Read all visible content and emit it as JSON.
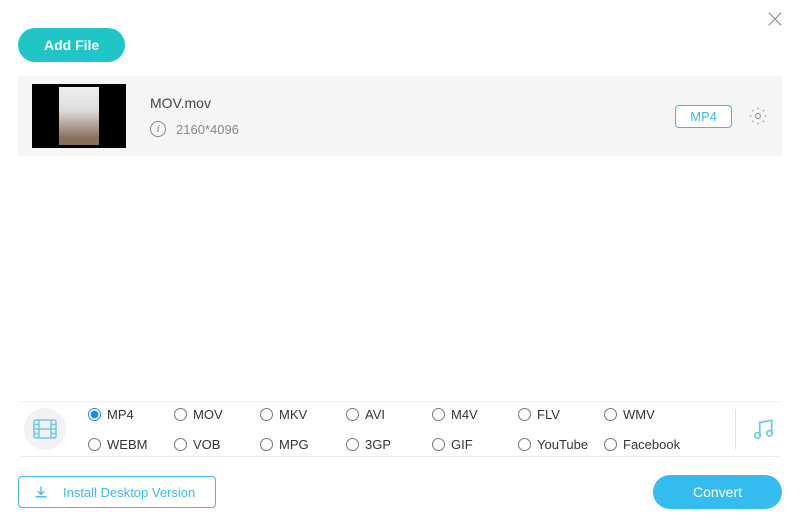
{
  "header": {
    "add_file_label": "Add File"
  },
  "file": {
    "name": "MOV.mov",
    "resolution": "2160*4096",
    "target_format": "MP4"
  },
  "formats": {
    "selected": "MP4",
    "options": [
      "MP4",
      "MOV",
      "MKV",
      "AVI",
      "M4V",
      "FLV",
      "WMV",
      "WEBM",
      "VOB",
      "MPG",
      "3GP",
      "GIF",
      "YouTube",
      "Facebook"
    ]
  },
  "footer": {
    "install_label": "Install Desktop Version",
    "convert_label": "Convert"
  }
}
